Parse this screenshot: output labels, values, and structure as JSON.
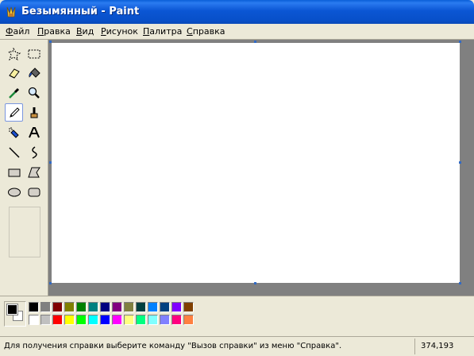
{
  "window": {
    "title": "Безымянный - Paint"
  },
  "menu": [
    {
      "first": "Ф",
      "rest": "айл"
    },
    {
      "first": "П",
      "rest": "равка"
    },
    {
      "first": "В",
      "rest": "ид"
    },
    {
      "first": "Р",
      "rest": "исунок"
    },
    {
      "first": "П",
      "rest": "алитра"
    },
    {
      "first": "С",
      "rest": "правка"
    }
  ],
  "tools": [
    "free-select-icon",
    "rect-select-icon",
    "eraser-icon",
    "fill-icon",
    "color-picker-icon",
    "magnifier-icon",
    "pencil-icon",
    "brush-icon",
    "airbrush-icon",
    "text-icon",
    "line-icon",
    "curve-icon",
    "rectangle-icon",
    "polygon-icon",
    "ellipse-icon",
    "rounded-rect-icon"
  ],
  "active_tool": "pencil-icon",
  "colors": {
    "foreground": "#000000",
    "background": "#ffffff",
    "palette_top": [
      "#000000",
      "#808080",
      "#800000",
      "#808000",
      "#008000",
      "#008080",
      "#000080",
      "#800080",
      "#808040",
      "#004040",
      "#0080ff",
      "#004080",
      "#8000ff",
      "#804000"
    ],
    "palette_bottom": [
      "#ffffff",
      "#c0c0c0",
      "#ff0000",
      "#ffff00",
      "#00ff00",
      "#00ffff",
      "#0000ff",
      "#ff00ff",
      "#ffff80",
      "#00ff80",
      "#80ffff",
      "#8080ff",
      "#ff0080",
      "#ff8040"
    ]
  },
  "status": {
    "help_text": "Для получения справки выберите команду \"Вызов справки\" из меню \"Справка\".",
    "coords": "374,193"
  }
}
